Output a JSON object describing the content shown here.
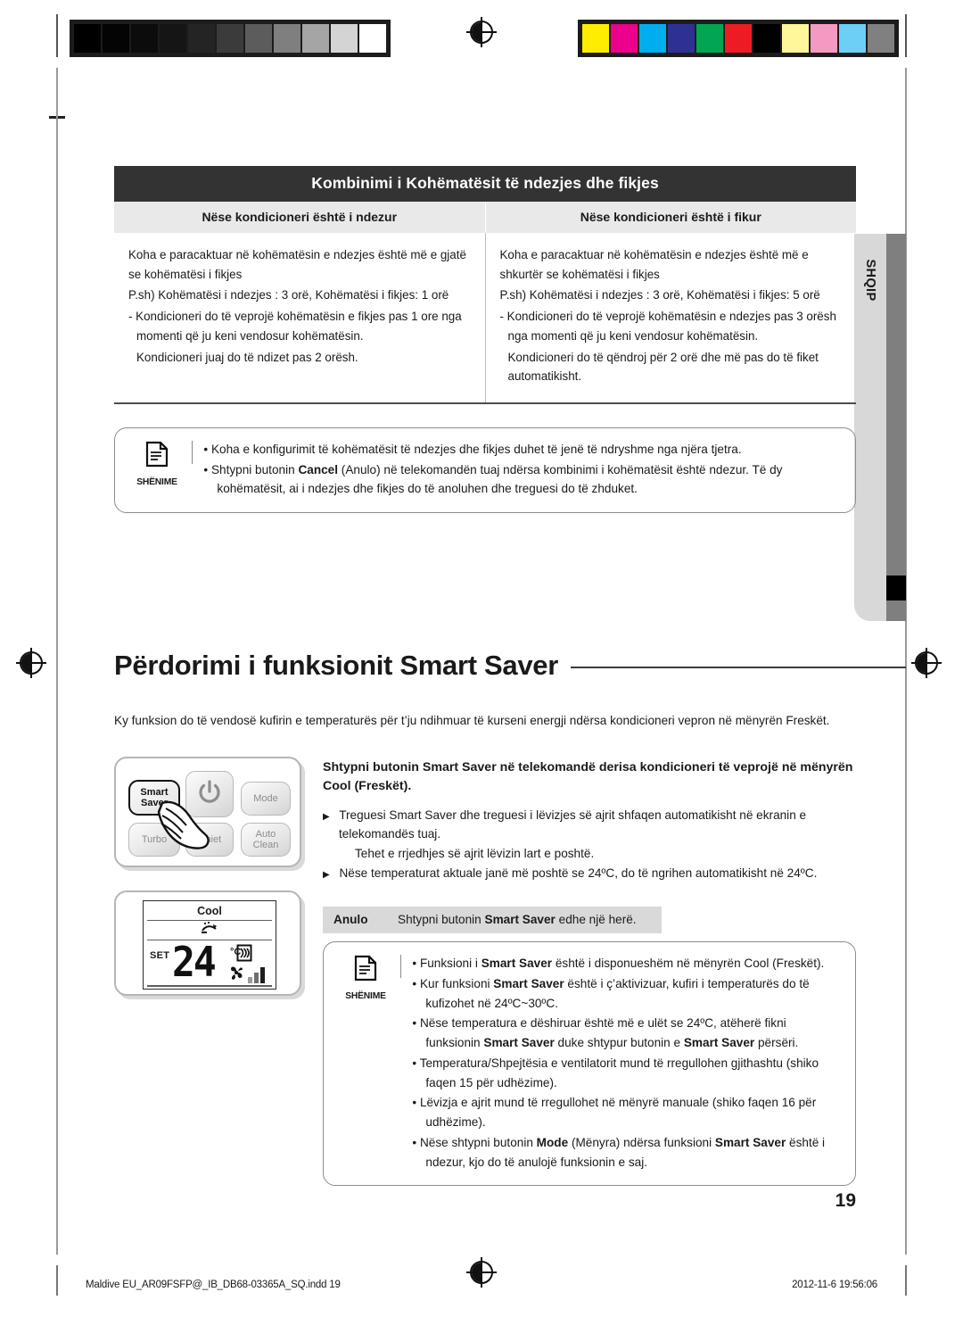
{
  "calibration": {
    "gray_swatches": [
      "#000000",
      "#040404",
      "#0c0c0c",
      "#151515",
      "#242424",
      "#3b3b3b",
      "#5c5c5c",
      "#7f7f7f",
      "#a5a5a5",
      "#d4d4d4",
      "#ffffff"
    ],
    "color_swatches": [
      "#ffed00",
      "#ec008c",
      "#00aeef",
      "#2e3192",
      "#00a651",
      "#ed1c24",
      "#000000",
      "#fff79a",
      "#f49ac1",
      "#6dcff6",
      "#808080"
    ]
  },
  "table": {
    "title": "Kombinimi i Kohëmatësit të ndezjes dhe fikjes",
    "columns": [
      "Nëse kondicioneri është i ndezur",
      "Nëse kondicioneri është i fikur"
    ],
    "rows": [
      {
        "lines": [
          "Koha e paracaktuar në kohëmatësin e ndezjes është më e gjatë se kohëmatësi i fikjes",
          "P.sh) Kohëmatësi i ndezjes : 3 orë, Kohëmatësi i fikjes: 1 orë",
          "- Kondicioneri do të veprojë kohëmatësin e fikjes pas 1 ore nga momenti që ju keni vendosur kohëmatësin.",
          "Kondicioneri juaj do të ndizet pas 2 orësh."
        ]
      },
      {
        "lines": [
          "Koha e paracaktuar në kohëmatësin e ndezjes është më e shkurtër se kohëmatësi i fikjes",
          "P.sh) Kohëmatësi i ndezjes : 3 orë, Kohëmatësi i fikjes: 5 orë",
          "- Kondicioneri do të veprojë kohëmatësin e ndezjes pas 3 orësh nga momenti që ju keni vendosur kohëmatësin.",
          "Kondicioneri do të qëndroj për 2 orë dhe më pas do të fiket automatikisht."
        ]
      }
    ]
  },
  "note_top": {
    "badge_label": "SHËNIME",
    "badge_icon": "document-note-icon",
    "items": [
      "Koha e konfigurimit të kohëmatësit të ndezjes dhe fikjes duhet të jenë të ndryshme nga njëra tjetra.",
      "Shtypni butonin Cancel (Anulo) në telekomandën tuaj ndërsa kombinimi i kohëmatësit është ndezur. Të dy kohëmatësit, ai i ndezjes dhe fikjes do të anoluhen dhe treguesi do të zhduket."
    ],
    "bold_terms": [
      "Cancel"
    ]
  },
  "side_tab": {
    "language": "SHQIP"
  },
  "section": {
    "heading": "Përdorimi i funksionit Smart Saver",
    "intro": "Ky funksion do të vendosë kufirin e temperaturës për t’ju ndihmuar të kurseni energji ndërsa kondicioneri vepron në mënyrën Freskët."
  },
  "remote": {
    "buttons": [
      {
        "name": "smart-saver",
        "label": "Smart\nSaver",
        "highlighted": true
      },
      {
        "name": "power",
        "label": "",
        "icon": "power-icon"
      },
      {
        "name": "mode",
        "label": "Mode"
      },
      {
        "name": "turbo",
        "label": "Turbo"
      },
      {
        "name": "quiet",
        "label": "Quiet"
      },
      {
        "name": "auto-clean",
        "label": "Auto\nClean"
      }
    ],
    "smart_saver_line1": "Smart",
    "smart_saver_line2": "Saver",
    "mode_label": "Mode",
    "turbo_label": "Turbo",
    "quiet_label": "Quiet",
    "auto_line1": "Auto",
    "auto_line2": "Clean",
    "hand_icon": "pointing-hand-icon"
  },
  "lcd": {
    "mode": "Cool",
    "set_label": "SET",
    "temperature": "24",
    "unit": "°C",
    "swing_icon": "air-swing-icon",
    "fan_icon": "fan-icon",
    "signal_icon": "fan-speed-bars-icon",
    "flap_icon": "air-flow-icon"
  },
  "instructions": {
    "lead": "Shtypni butonin Smart Saver në telekomandë derisa kondicioneri të veprojë në mënyrën Cool (Freskët).",
    "lead_bold": "Smart Saver",
    "bullets": [
      {
        "text": "Treguesi Smart Saver dhe treguesi i lëvizjes së ajrit shfaqen automatikisht në ekranin e telekomandës tuaj.",
        "sub": "Tehet e rrjedhjes së ajrit lëvizin lart e poshtë."
      },
      {
        "text": "Nëse temperaturat aktuale janë më poshtë se 24ºC, do të ngrihen automatikisht në 24ºC.",
        "sub": ""
      }
    ]
  },
  "cancel": {
    "key": "Anulo",
    "text": "Shtypni butonin Smart Saver edhe një herë.",
    "bold_term": "Smart Saver"
  },
  "note_bottom": {
    "badge_label": "SHËNIME",
    "badge_icon": "document-note-icon",
    "items": [
      "Funksioni i Smart Saver është i disponueshëm në mënyrën Cool (Freskët).",
      "Kur funksioni Smart Saver është i ç’aktivizuar, kufiri i temperaturës do të kufizohet në 24ºC~30ºC.",
      "Nëse temperatura e dëshiruar është më e ulët se 24ºC, atëherë fikni funksionin Smart Saver duke shtypur butonin e Smart Saver përsëri.",
      "Temperatura/Shpejtësia e ventilatorit mund të rregullohen gjithashtu (shiko faqen 15 për udhëzime).",
      "Lëvizja e ajrit mund të rregullohet në mënyrë manuale (shiko faqen 16 për udhëzime).",
      "Nëse shtypni butonin Mode (Mënyra) ndërsa funksioni Smart Saver është i ndezur, kjo do të anulojë funksionin e saj."
    ],
    "bold_terms": [
      "Smart Saver",
      "Mode"
    ]
  },
  "footer": {
    "page_number": "19",
    "file_name": "Maldive EU_AR09FSFP@_IB_DB68-03365A_SQ.indd   19",
    "timestamp": "2012-11-6   19:56:06"
  }
}
